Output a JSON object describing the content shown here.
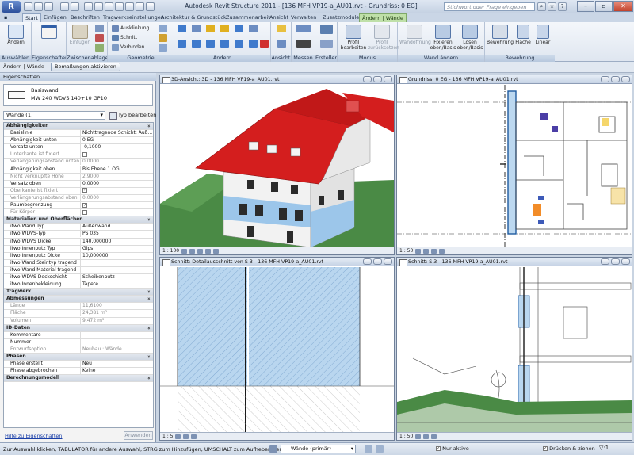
{
  "app": {
    "title": "Autodesk Revit Structure 2011 - [136 MFH VP19-a_AU01.rvt - Grundriss: 0 EG]",
    "search_placeholder": "Stichwort oder Frage eingeben"
  },
  "tabs": [
    "Start",
    "Einfügen",
    "Beschriften",
    "Tragwerkseinstellungen",
    "Architektur & Grundstück",
    "Zusammenarbeit",
    "Ansicht",
    "Verwalten",
    "Zusatzmodule",
    "Ändern | Wände"
  ],
  "ribbon": {
    "panels": [
      "Auswählen",
      "Eigenschaften",
      "Zwischenablage",
      "Geometrie",
      "Ändern",
      "Ansicht",
      "Messen",
      "Erstellen",
      "Modus",
      "Wand ändern",
      "Bewehrung"
    ],
    "modify_label": "Ändern",
    "paste_label": "Einfügen",
    "geometry_items": [
      "Ausklinkung",
      "Schnitt",
      "Verbinden"
    ],
    "profile_edit": "Profil bearbeiten",
    "profile_reset": "Profil zurücksetzen",
    "wall_opening": "Wandöffnung",
    "attach": "Fixieren oben/Basis",
    "detach": "Lösen oben/Basis",
    "reinforcement": "Bewehrung",
    "area": "Fläche",
    "linear": "Linear"
  },
  "options_bar": {
    "mode": "Ändern | Wände",
    "tag_button": "Bemaßungen aktivieren"
  },
  "properties": {
    "header": "Eigenschaften",
    "type_name": "Basiswand",
    "type_sub": "MW 240 WDVS 140+10 GP10",
    "instance_filter": "Wände (1)",
    "edit_type": "Typ bearbeiten",
    "rows": [
      {
        "s": "Abhängigkeiten"
      },
      {
        "k": "Basislinie",
        "v": "Nichttragende Schicht: Auß..."
      },
      {
        "k": "Abhängigkeit unten",
        "v": "0 EG"
      },
      {
        "k": "Versatz unten",
        "v": "-0,1000"
      },
      {
        "k": "Unterkante ist fixiert",
        "v": "",
        "g": true,
        "c": ""
      },
      {
        "k": "Verlängerungsabstand unten",
        "v": "0,0000",
        "g": true
      },
      {
        "k": "Abhängigkeit oben",
        "v": "Bis Ebene 1 OG"
      },
      {
        "k": "Nicht verknüpfte Höhe",
        "v": "2,9000",
        "g": true
      },
      {
        "k": "Versatz oben",
        "v": "0,0000"
      },
      {
        "k": "Oberkante ist fixiert",
        "v": "",
        "g": true,
        "c": "✓"
      },
      {
        "k": "Verlängerungsabstand oben",
        "v": "0,0000",
        "g": true
      },
      {
        "k": "Raumbegrenzung",
        "v": "",
        "c": "✓"
      },
      {
        "k": "Für Körper",
        "v": "",
        "g": true,
        "c": ""
      },
      {
        "s": "Materialien und Oberflächen"
      },
      {
        "k": "itwo Wand Typ",
        "v": "Außenwand"
      },
      {
        "k": "itwo WDVS-Typ",
        "v": "PS 035"
      },
      {
        "k": "itwo WDVS Dicke",
        "v": "140,000000"
      },
      {
        "k": "itwo Innenputz Typ",
        "v": "Gips"
      },
      {
        "k": "itwo Innenputz Dicke",
        "v": "10,000000"
      },
      {
        "k": "itwo Wand Steintyp tragend",
        "v": ""
      },
      {
        "k": "itwo Wand Material tragend",
        "v": ""
      },
      {
        "k": "itwo WDVS Deckschicht",
        "v": "Scheibenputz"
      },
      {
        "k": "itwo Innenbekleidung",
        "v": "Tapete"
      },
      {
        "s": "Tragwerk"
      },
      {
        "s": "Abmessungen"
      },
      {
        "k": "Länge",
        "v": "11,6100",
        "g": true
      },
      {
        "k": "Fläche",
        "v": "24,381 m²",
        "g": true
      },
      {
        "k": "Volumen",
        "v": "9,472 m³",
        "g": true
      },
      {
        "s": "ID-Daten"
      },
      {
        "k": "Kommentare",
        "v": ""
      },
      {
        "k": "Nummer",
        "v": ""
      },
      {
        "k": "Entwurfsoption",
        "v": "Neubau : Wände",
        "g": true
      },
      {
        "s": "Phasen"
      },
      {
        "k": "Phase erstellt",
        "v": "Neu"
      },
      {
        "k": "Phase abgebrochen",
        "v": "Keine"
      },
      {
        "s": "Berechnungsmodell"
      }
    ],
    "help_link": "Hilfe zu Eigenschaften",
    "apply": "Anwenden"
  },
  "views": [
    {
      "title": "3D-Ansicht: 3D - 136 MFH VP19-a_AU01.rvt",
      "scale": "1 : 100"
    },
    {
      "title": "Grundriss: 0 EG - 136 MFH VP19-a_AU01.rvt",
      "scale": "1 : 50"
    },
    {
      "title": "Schnitt: Detailausschnitt von S 3 - 136 MFH VP19-a_AU01.rvt",
      "scale": "1 : 5"
    },
    {
      "title": "Schnitt: S 3 - 136 MFH VP19-a_AU01.rvt",
      "scale": "1 : 50"
    }
  ],
  "status": {
    "hint": "Zur Auswahl klicken, TABULATOR für andere Auswahl, STRG zum Hinzufügen, UMSCHALT zum Aufheben der Auswahl.",
    "workset": "Wände (primär)",
    "active_only": "Nur aktive",
    "press_drag": "Drücken & ziehen",
    "filter_count": ":1"
  },
  "colors": {
    "roof": "#d41e1e",
    "wall_blue": "#9cc6ea",
    "ground": "#4a8a45",
    "context_tab": "#bfe0a8"
  }
}
